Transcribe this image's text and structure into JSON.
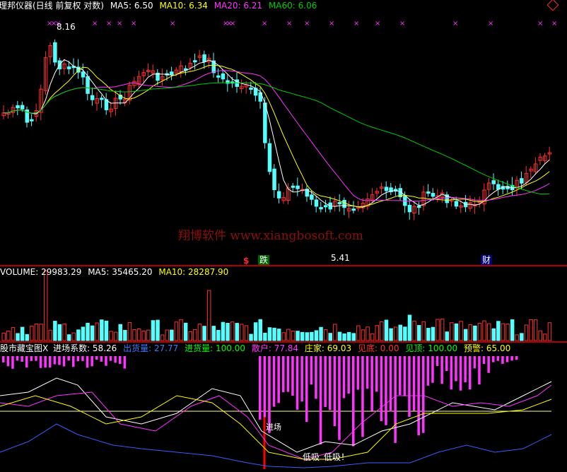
{
  "header": {
    "title": "理邦仪器(日线 前复权 对数)",
    "ma5": "MA5: 6.50",
    "ma10": "MA10: 6.34",
    "ma20": "MA20: 6.21",
    "ma60": "MA60: 6.06"
  },
  "price_panel": {
    "high_label": "8.16",
    "low_label": "5.41",
    "watermark": "翔博软件 www.xiangbosoft.com",
    "event_marks": [
      {
        "text": "$",
        "color": "#ff2a2a"
      },
      {
        "text": "跌",
        "color": "#ffffff",
        "bg": "#006400"
      },
      {
        "text": "财",
        "color": "#ffffff",
        "bg": "#000080"
      }
    ]
  },
  "volume_panel": {
    "volume": "VOLUME: 29983.29",
    "ma5": "MA5: 35465.20",
    "ma10": "MA10: 28287.90"
  },
  "indicator_panel": {
    "name": "股市藏宝图X",
    "entry": "进场系数: 58.26",
    "out_vol": "出货量: 27.77",
    "in_vol": "进货量: 100.00",
    "retail": "散户: 77.84",
    "dealer": "庄家: 69.03",
    "bottom": "见底: 0.00",
    "top": "见顶: 100.00",
    "warn": "预警: 65.00",
    "annot_entry": "进场",
    "annot_low": "低吸",
    "annot_low2": "低吸！"
  },
  "colors": {
    "up": "#ff3030",
    "down": "#54ffff",
    "ma5": "#ffffff",
    "ma10": "#ffff00",
    "ma20": "#ff33ff",
    "ma60": "#00cc00",
    "separator": "#b00000"
  },
  "icons": {
    "diamond": "diamond-icon"
  }
}
